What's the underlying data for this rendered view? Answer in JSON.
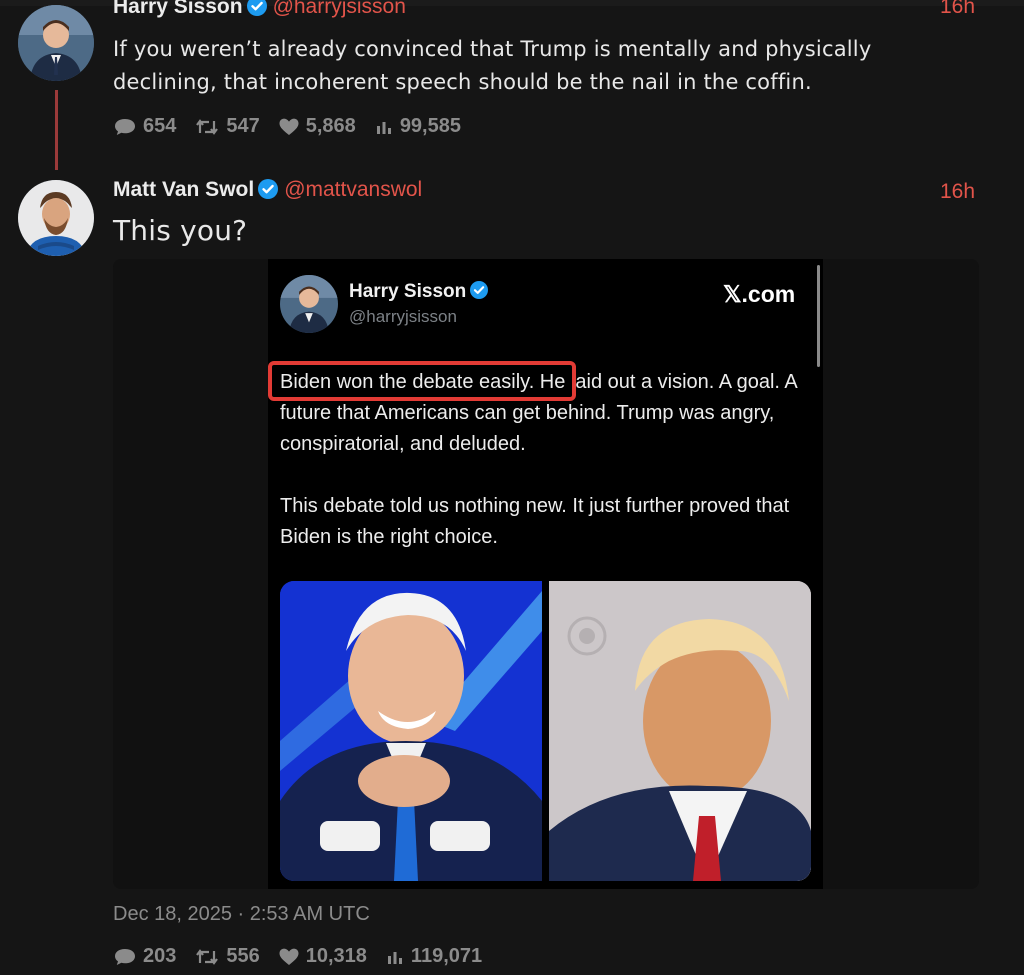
{
  "tweets": [
    {
      "author_name": "Harry Sisson",
      "handle": "@harryjsisson",
      "time": "16h",
      "text": "If you weren’t already convinced that Trump is mentally and physically declining, that incoherent speech should be the nail in the coffin.",
      "stats": {
        "replies": "654",
        "retweets": "547",
        "likes": "5,868",
        "views": "99,585"
      }
    },
    {
      "author_name": "Matt Van Swol",
      "handle": "@mattvanswol",
      "time": "16h",
      "text": "This you?",
      "date": "Dec 18, 2025 · 2:53 AM UTC",
      "stats": {
        "replies": "203",
        "retweets": "556",
        "likes": "10,318",
        "views": "119,071"
      }
    }
  ],
  "embedded_post": {
    "author_name": "Harry Sisson",
    "handle": "@harryjsisson",
    "site": "𝕏.com",
    "highlighted_text": "Biden won the debate easily.",
    "text_rest": " He laid out a vision. A goal. A future that Americans can get behind. Trump was angry, conspiratorial, and deluded.",
    "paragraph2": "This debate told us nothing new. It just further proved that Biden is the right choice."
  },
  "colors": {
    "accent": "#e2544a",
    "verified": "#1d9bf0",
    "background": "#151515",
    "highlight_box": "#e23b35"
  },
  "icons": [
    "comment-icon",
    "retweet-icon",
    "heart-icon",
    "views-icon",
    "verified-icon"
  ]
}
